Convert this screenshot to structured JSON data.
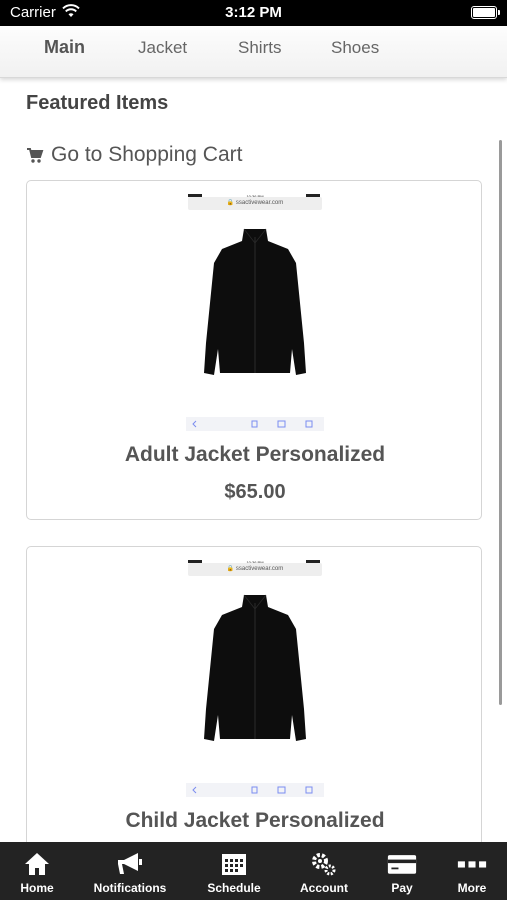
{
  "status_bar": {
    "carrier": "Carrier",
    "time": "3:12 PM"
  },
  "top_tabs": [
    {
      "label": "Main",
      "active": true
    },
    {
      "label": "Jacket",
      "active": false
    },
    {
      "label": "Shirts",
      "active": false
    },
    {
      "label": "Shoes",
      "active": false
    }
  ],
  "featured_title": "Featured Items",
  "cart_link_label": "Go to Shopping Cart",
  "products": [
    {
      "name": "Adult Jacket Personalized",
      "price": "$65.00",
      "thumb_url": "ssactivewear.com",
      "thumb_status_time": "10:36 PM"
    },
    {
      "name": "Child Jacket Personalized",
      "price": "",
      "thumb_url": "ssactivewear.com",
      "thumb_status_time": "10:36 PM"
    }
  ],
  "bottom_tabs": [
    {
      "label": "Home",
      "icon": "home-icon"
    },
    {
      "label": "Notifications",
      "icon": "megaphone-icon"
    },
    {
      "label": "Schedule",
      "icon": "calendar-icon"
    },
    {
      "label": "Account",
      "icon": "gears-icon"
    },
    {
      "label": "Pay",
      "icon": "credit-card-icon"
    },
    {
      "label": "More",
      "icon": "more-dots-icon"
    }
  ],
  "colors": {
    "status_bar": "#000000",
    "tabbar": "#232323",
    "text": "#555555"
  }
}
